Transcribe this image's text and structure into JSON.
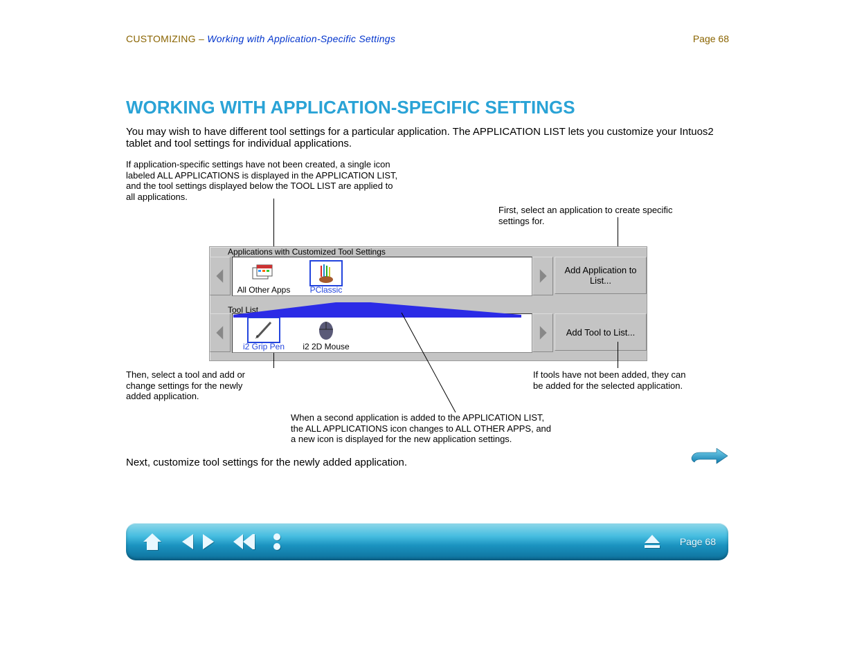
{
  "header": {
    "left_prefix": "CUSTOMIZING – ",
    "left_link": "Working with Application-Specific Settings",
    "right": "Page 68"
  },
  "section_title": "WORKING WITH APPLICATION-SPECIFIC SETTINGS",
  "body": {
    "p1": "You may wish to have different tool settings for a particular application. The APPLICATION LIST lets you customize your Intuos2 tablet and tool settings for individual applications.",
    "p2": "Next, customize tool settings for the newly added application."
  },
  "panel": {
    "apps": {
      "label": "Applications with Customized Tool Settings",
      "items": [
        {
          "label": "All Other Apps",
          "selected": false,
          "icon": "stacked-windows"
        },
        {
          "label": "PClassic",
          "selected": true,
          "icon": "paint-brushes"
        }
      ],
      "add_button": "Add Application to List..."
    },
    "tools": {
      "label": "Tool List",
      "items": [
        {
          "label": "i2 Grip Pen",
          "selected": true,
          "icon": "pen"
        },
        {
          "label": "i2 2D Mouse",
          "selected": false,
          "icon": "mouse"
        }
      ],
      "add_button": "Add Tool to List..."
    }
  },
  "callouts": {
    "c1": "If application-specific settings have not been created, a single icon labeled ALL APPLICATIONS is displayed in the APPLICATION LIST, and the tool settings displayed below the TOOL LIST are applied to all applications.",
    "c2": "First, select an application to create specific settings for.",
    "c3": "Then, select a tool and add or change settings for the newly added application.",
    "c4": "When a second application is added to the APPLICATION LIST, the ALL APPLICATIONS icon changes to ALL OTHER APPS, and a new icon is displayed for the new application settings.",
    "c5": "If tools have not been added, they can be added for the selected application."
  },
  "nav": {
    "home_label": "home",
    "back_label": "back",
    "fwd_label": "forward",
    "rewind_label": "first",
    "more_label": "more",
    "eject_label": "eject",
    "page": "Page 68"
  }
}
